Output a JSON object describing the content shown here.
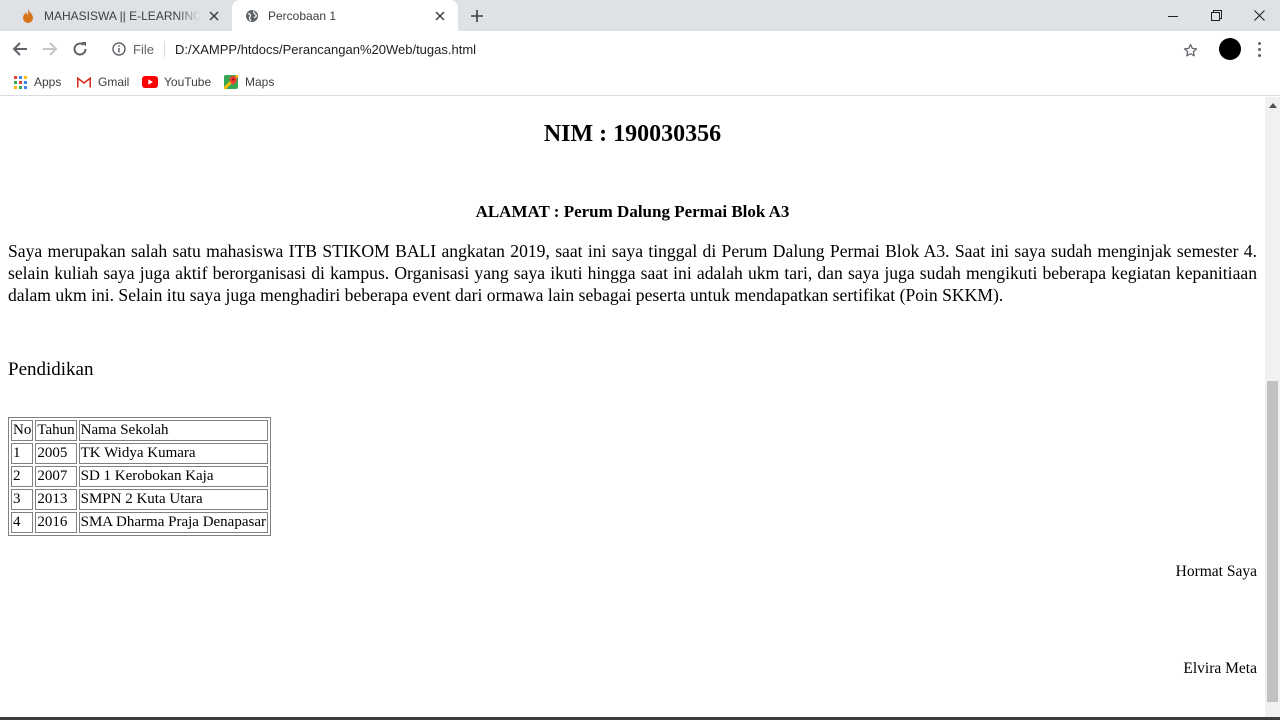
{
  "browser": {
    "tabs": [
      {
        "title": "MAHASISWA || E-LEARNING STIKOM",
        "active": false,
        "favicon": "flame-icon"
      },
      {
        "title": "Percobaan 1",
        "active": true,
        "favicon": "globe-icon"
      }
    ],
    "address": {
      "scheme_label": "File",
      "url": "D:/XAMPP/htdocs/Perancangan%20Web/tugas.html"
    },
    "bookmarks": [
      {
        "label": "Apps",
        "icon": "apps-grid-icon"
      },
      {
        "label": "Gmail",
        "icon": "gmail-icon"
      },
      {
        "label": "YouTube",
        "icon": "youtube-icon"
      },
      {
        "label": "Maps",
        "icon": "maps-icon"
      }
    ],
    "colors": {
      "tabstrip": "#dee1e6",
      "scroll_thumb": "#c1c1c1"
    }
  },
  "page": {
    "nim": "NIM : 190030356",
    "alamat": "ALAMAT : Perum Dalung Permai Blok A3",
    "paragraph": "Saya merupakan salah satu mahasiswa ITB STIKOM BALI angkatan 2019, saat ini saya tinggal di Perum Dalung Permai Blok A3. Saat ini saya sudah menginjak semester 4. selain kuliah saya juga aktif berorganisasi di kampus. Organisasi yang saya ikuti hingga saat ini adalah ukm tari, dan saya juga sudah mengikuti beberapa kegiatan kepanitiaan dalam ukm ini. Selain itu saya juga menghadiri beberapa event dari ormawa lain sebagai peserta untuk mendapatkan sertifikat (Poin SKKM).",
    "section_title": "Pendidikan",
    "table": {
      "headers": [
        "No",
        "Tahun",
        "Nama Sekolah"
      ],
      "rows": [
        [
          "1",
          "2005",
          "TK Widya Kumara"
        ],
        [
          "2",
          "2007",
          "SD 1 Kerobokan Kaja"
        ],
        [
          "3",
          "2013",
          "SMPN 2 Kuta Utara"
        ],
        [
          "4",
          "2016",
          "SMA Dharma Praja Denapasar"
        ]
      ]
    },
    "closing": "Hormat Saya",
    "signer": "Elvira Meta"
  }
}
